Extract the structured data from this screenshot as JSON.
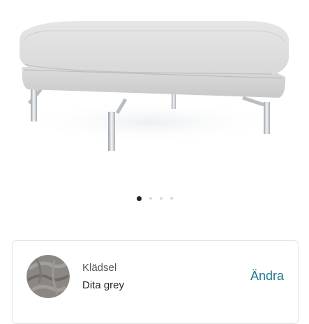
{
  "product": {
    "image_alt": "Light grey fabric ottoman with chrome legs",
    "carousel": {
      "total": 4,
      "active_index": 0
    }
  },
  "upholstery": {
    "label": "Klädsel",
    "value": "Dita grey",
    "change_label": "Ändra",
    "swatch_color": "#8a8784"
  },
  "colors": {
    "accent": "#1f7a8c",
    "fabric": "#dcdcdc",
    "chrome": "#c8ccd0"
  }
}
